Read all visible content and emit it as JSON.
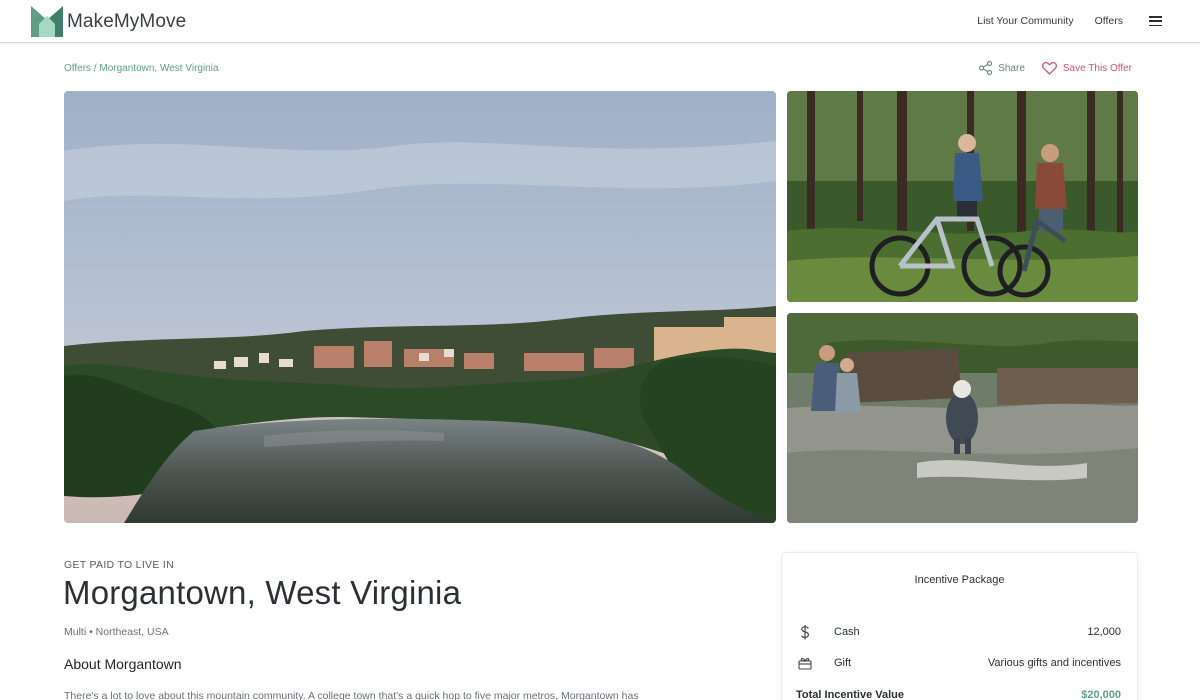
{
  "brand": {
    "name": "MakeMyMove",
    "colors": {
      "green": "#5d9e85",
      "pink": "#c7586a",
      "text": "#2b3034"
    }
  },
  "nav": {
    "items": [
      {
        "label": "List Your Community"
      },
      {
        "label": "Offers"
      }
    ],
    "menu_icon": "hamburger-menu-icon"
  },
  "breadcrumb": {
    "parent": "Offers",
    "separator": " / ",
    "current": "Morgantown, West Virginia"
  },
  "actions": {
    "share_label": "Share",
    "share_icon": "share-icon",
    "save_label": "Save This Offer",
    "save_icon": "heart-icon"
  },
  "photos": [
    {
      "subject": "river-and-town"
    },
    {
      "subject": "mountain-bikers"
    },
    {
      "subject": "couple-and-dog-in-creek"
    }
  ],
  "offer": {
    "eyebrow": "GET PAID TO LIVE IN",
    "title": "Morgantown, West Virginia",
    "meta": "Multi • Northeast, USA",
    "about_title": "About Morgantown",
    "about_text": "There's a lot to love about this mountain community. A college town that's a quick hop to five major metros, Morgantown has"
  },
  "incentive": {
    "title": "Incentive Package",
    "rows": [
      {
        "icon": "dollar-icon",
        "label": "Cash",
        "value": "12,000"
      },
      {
        "icon": "gift-icon",
        "label": "Gift",
        "value": "Various gifts and incentives"
      }
    ],
    "total_label": "Total Incentive Value",
    "total_value": "$20,000"
  }
}
